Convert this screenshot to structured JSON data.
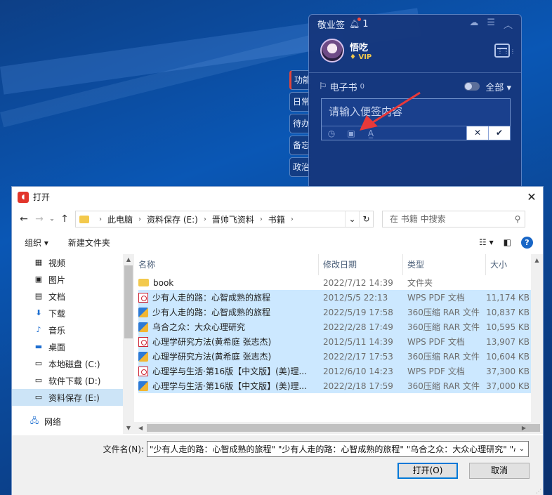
{
  "sticky": {
    "title": "敬业签",
    "notif_count": "1",
    "user_name": "悟吃",
    "vip": "VIP",
    "category": "电子书",
    "category_count": "0",
    "filter": "全部",
    "placeholder": "请输入便签内容",
    "side_tabs": [
      "功能",
      "日常",
      "待办",
      "备忘",
      "政治"
    ]
  },
  "dialog": {
    "title": "打开",
    "breadcrumb": [
      "此电脑",
      "资料保存 (E:)",
      "晋帅飞资料",
      "书籍"
    ],
    "search_placeholder": "在 书籍 中搜索",
    "organize": "组织 ▾",
    "new_folder": "新建文件夹",
    "nav_items": [
      {
        "label": "视频",
        "icon": "video-icon"
      },
      {
        "label": "图片",
        "icon": "pictures-icon"
      },
      {
        "label": "文档",
        "icon": "documents-icon"
      },
      {
        "label": "下载",
        "icon": "download-icon"
      },
      {
        "label": "音乐",
        "icon": "music-icon"
      },
      {
        "label": "桌面",
        "icon": "desktop-icon"
      },
      {
        "label": "本地磁盘 (C:)",
        "icon": "drive-icon"
      },
      {
        "label": "软件下载 (D:)",
        "icon": "drive-icon"
      },
      {
        "label": "资料保存 (E:)",
        "icon": "drive-icon"
      },
      {
        "label": "网络",
        "icon": "network-icon"
      }
    ],
    "columns": {
      "name": "名称",
      "date": "修改日期",
      "type": "类型",
      "size": "大小"
    },
    "files": [
      {
        "name": "book",
        "date": "2022/7/12 14:39",
        "type": "文件夹",
        "size": "",
        "kind": "folder",
        "selected": false
      },
      {
        "name": "少有人走的路：心智成熟的旅程",
        "date": "2012/5/5 22:13",
        "type": "WPS PDF 文档",
        "size": "11,174 KB",
        "kind": "pdf",
        "selected": true
      },
      {
        "name": "少有人走的路：心智成熟的旅程",
        "date": "2022/5/19 17:58",
        "type": "360压缩 RAR 文件",
        "size": "10,837 KB",
        "kind": "rar",
        "selected": true
      },
      {
        "name": "乌合之众：大众心理研究",
        "date": "2022/2/28 17:49",
        "type": "360压缩 RAR 文件",
        "size": "10,595 KB",
        "kind": "rar",
        "selected": true
      },
      {
        "name": "心理学研究方法(黄希庭 张志杰)",
        "date": "2012/5/11 14:39",
        "type": "WPS PDF 文档",
        "size": "13,907 KB",
        "kind": "pdf",
        "selected": true
      },
      {
        "name": "心理学研究方法(黄希庭 张志杰)",
        "date": "2022/2/17 17:53",
        "type": "360压缩 RAR 文件",
        "size": "10,604 KB",
        "kind": "rar",
        "selected": true
      },
      {
        "name": "心理学与生活·第16版【中文版】(美)理...",
        "date": "2012/6/10 14:23",
        "type": "WPS PDF 文档",
        "size": "37,300 KB",
        "kind": "pdf",
        "selected": true
      },
      {
        "name": "心理学与生活·第16版【中文版】(美)理...",
        "date": "2022/2/18 17:59",
        "type": "360压缩 RAR 文件",
        "size": "37,000 KB",
        "kind": "rar",
        "selected": true
      }
    ],
    "filename_label": "文件名(N):",
    "filename_value": "\"少有人走的路：心智成熟的旅程\" \"少有人走的路：心智成熟的旅程\" \"乌合之众：大众心理研究\" \"心",
    "open_button": "打开(O)",
    "cancel_button": "取消"
  }
}
